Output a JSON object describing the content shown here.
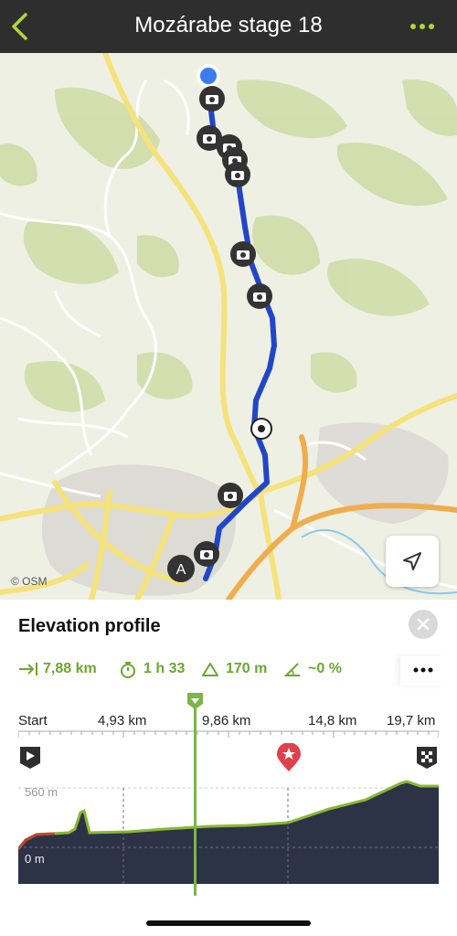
{
  "header": {
    "title": "Mozárabe stage 18",
    "back_icon": "chevron-left-icon",
    "more_icon": "more-dots-icon",
    "accent": "#b5d43a"
  },
  "map": {
    "attribution": "© OSM",
    "start_marker_label": "A",
    "locate_icon": "navigation-arrow-icon",
    "route_color": "#2146c7"
  },
  "panel": {
    "title": "Elevation profile",
    "close_icon": "close-icon",
    "stats": {
      "distance": "7,88 km",
      "duration": "1 h 33",
      "ascent": "170 m",
      "slope": "~0 %",
      "color": "#6aa82e"
    },
    "more_icon": "more-dots-icon",
    "axis": {
      "ticks": [
        "Start",
        "4,93 km",
        "9,86 km",
        "14,8 km",
        "19,7 km"
      ],
      "elev_high": "560 m",
      "elev_low": "0 m"
    },
    "icons": {
      "start": "play-flag-icon",
      "poi": "star-pin-icon",
      "finish": "checkered-flag-icon"
    }
  }
}
